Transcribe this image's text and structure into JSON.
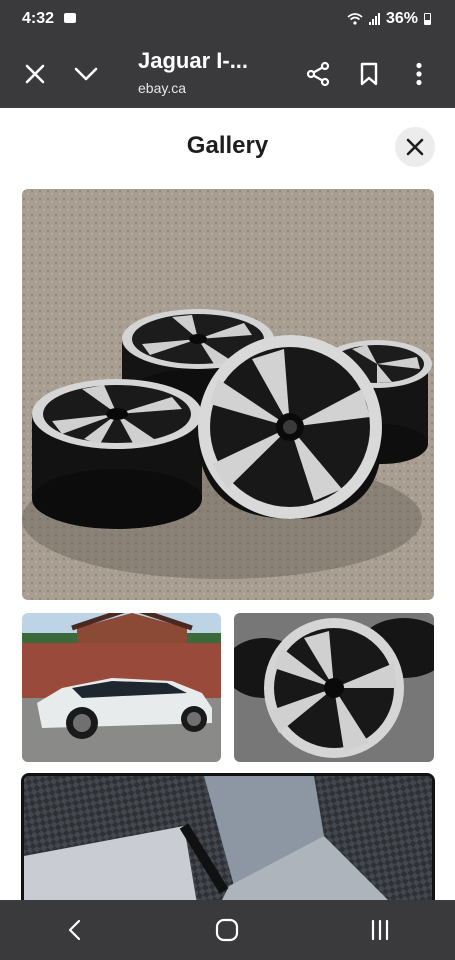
{
  "status": {
    "time": "4:32",
    "battery": "36%"
  },
  "header": {
    "title": "Jaguar I-...",
    "subtitle": "ebay.ca"
  },
  "gallery": {
    "title": "Gallery"
  },
  "icons": {
    "close": "close-icon",
    "expand": "chevron-down-icon",
    "share": "share-icon",
    "bookmark": "bookmark-icon",
    "more": "more-vert-icon",
    "back": "back-icon",
    "home": "home-icon",
    "recents": "recents-icon"
  }
}
